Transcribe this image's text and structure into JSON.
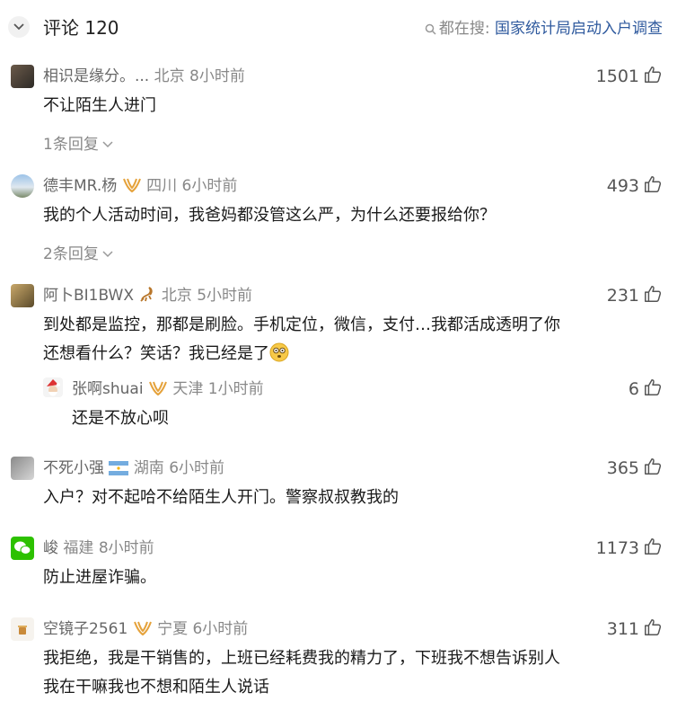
{
  "header": {
    "title": "评论 120",
    "search_prefix": "都在搜:",
    "search_link": "国家统计局启动入户调查"
  },
  "comments": [
    {
      "username": "相识是缘分。...",
      "location": "北京",
      "time": "8小时前",
      "likes": "1501",
      "text": "不让陌生人进门",
      "replies": "1条回复"
    },
    {
      "username": "德丰MR.杨",
      "location": "四川",
      "time": "6小时前",
      "likes": "493",
      "text": "我的个人活动时间，我爸妈都没管这么严，为什么还要报给你？",
      "replies": "2条回复"
    },
    {
      "username": "阿卜BI1BWX",
      "location": "北京",
      "time": "5小时前",
      "likes": "231",
      "text_line1": "到处都是监控，那都是刷脸。手机定位，微信，支付…我都活成透明了你",
      "text_line2": "还想看什么？笑话？我已经是了",
      "sub_reply": {
        "username": "张啊shuai",
        "location": "天津",
        "time": "1小时前",
        "likes": "6",
        "text": "还是不放心呗"
      }
    },
    {
      "username": "不死小强",
      "location": "湖南",
      "time": "6小时前",
      "likes": "365",
      "text": "入户？对不起哈不给陌生人开门。警察叔叔教我的"
    },
    {
      "username": "峻",
      "location": "福建",
      "time": "8小时前",
      "likes": "1173",
      "text": "防止进屋诈骗。"
    },
    {
      "username": "空镜子2561",
      "location": "宁夏",
      "time": "6小时前",
      "likes": "311",
      "text_line1": "我拒绝，我是干销售的，上班已经耗费我的精力了，下班我不想告诉别人",
      "text_line2": "我在干嘛我也不想和陌生人说话"
    }
  ]
}
